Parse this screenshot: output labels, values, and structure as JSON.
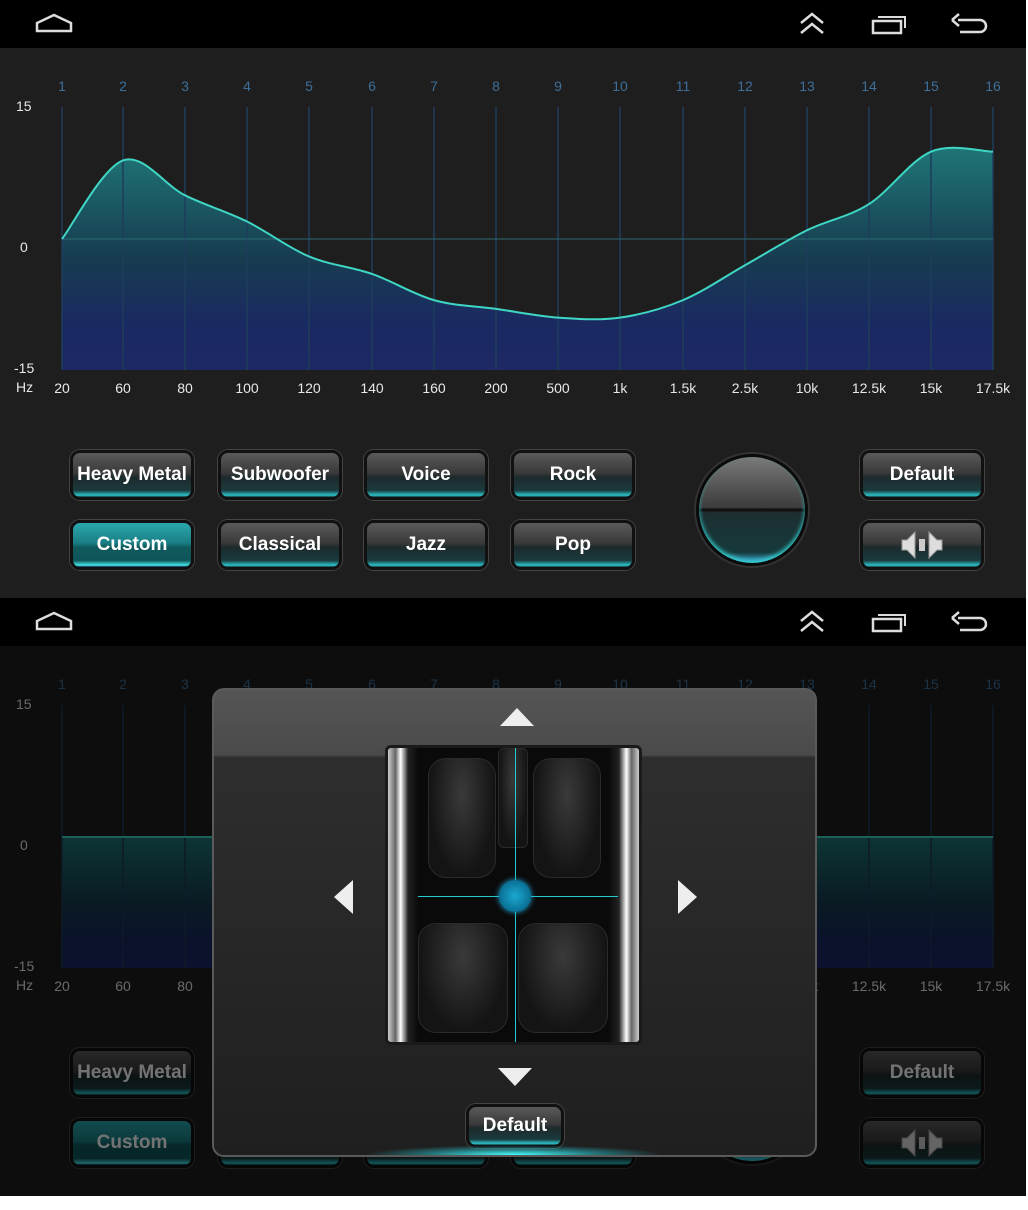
{
  "nav": {
    "home_icon": "home-icon",
    "up_icon": "double-chevron-up-icon",
    "recent_icon": "recent-apps-icon",
    "back_icon": "back-arrow-icon"
  },
  "eq": {
    "y_labels": {
      "top": "15",
      "mid": "0",
      "bottom": "-15",
      "unit": "Hz"
    },
    "bands": [
      "1",
      "2",
      "3",
      "4",
      "5",
      "6",
      "7",
      "8",
      "9",
      "10",
      "11",
      "12",
      "13",
      "14",
      "15",
      "16"
    ],
    "freqs": [
      "20",
      "60",
      "80",
      "100",
      "120",
      "140",
      "160",
      "200",
      "500",
      "1k",
      "1.5k",
      "2.5k",
      "10k",
      "12.5k",
      "15k",
      "17.5k"
    ],
    "ylim": [
      -15,
      15
    ],
    "accent": "#3fd6c4"
  },
  "presets": {
    "heavy_metal": "Heavy Metal",
    "subwoofer": "Subwoofer",
    "voice": "Voice",
    "rock": "Rock",
    "custom": "Custom",
    "classical": "Classical",
    "jazz": "Jazz",
    "pop": "Pop",
    "default": "Default",
    "balance_icon": "speaker-balance-icon"
  },
  "screens": [
    {
      "active_preset": "Custom",
      "eq_values": [
        0,
        9,
        5,
        2,
        -2,
        -4,
        -7,
        -8,
        -9,
        -9,
        -7,
        -3,
        1,
        4,
        10,
        10
      ],
      "popup_open": false
    },
    {
      "active_preset": "Custom",
      "eq_values": [
        0,
        0,
        0,
        0,
        0,
        0,
        0,
        0,
        0,
        0,
        0,
        0,
        0,
        0,
        0,
        0
      ],
      "popup_open": true
    }
  ],
  "balance_popup": {
    "default_label": "Default",
    "fader": 0,
    "balance": 0,
    "image": "car-interior-top-view"
  }
}
